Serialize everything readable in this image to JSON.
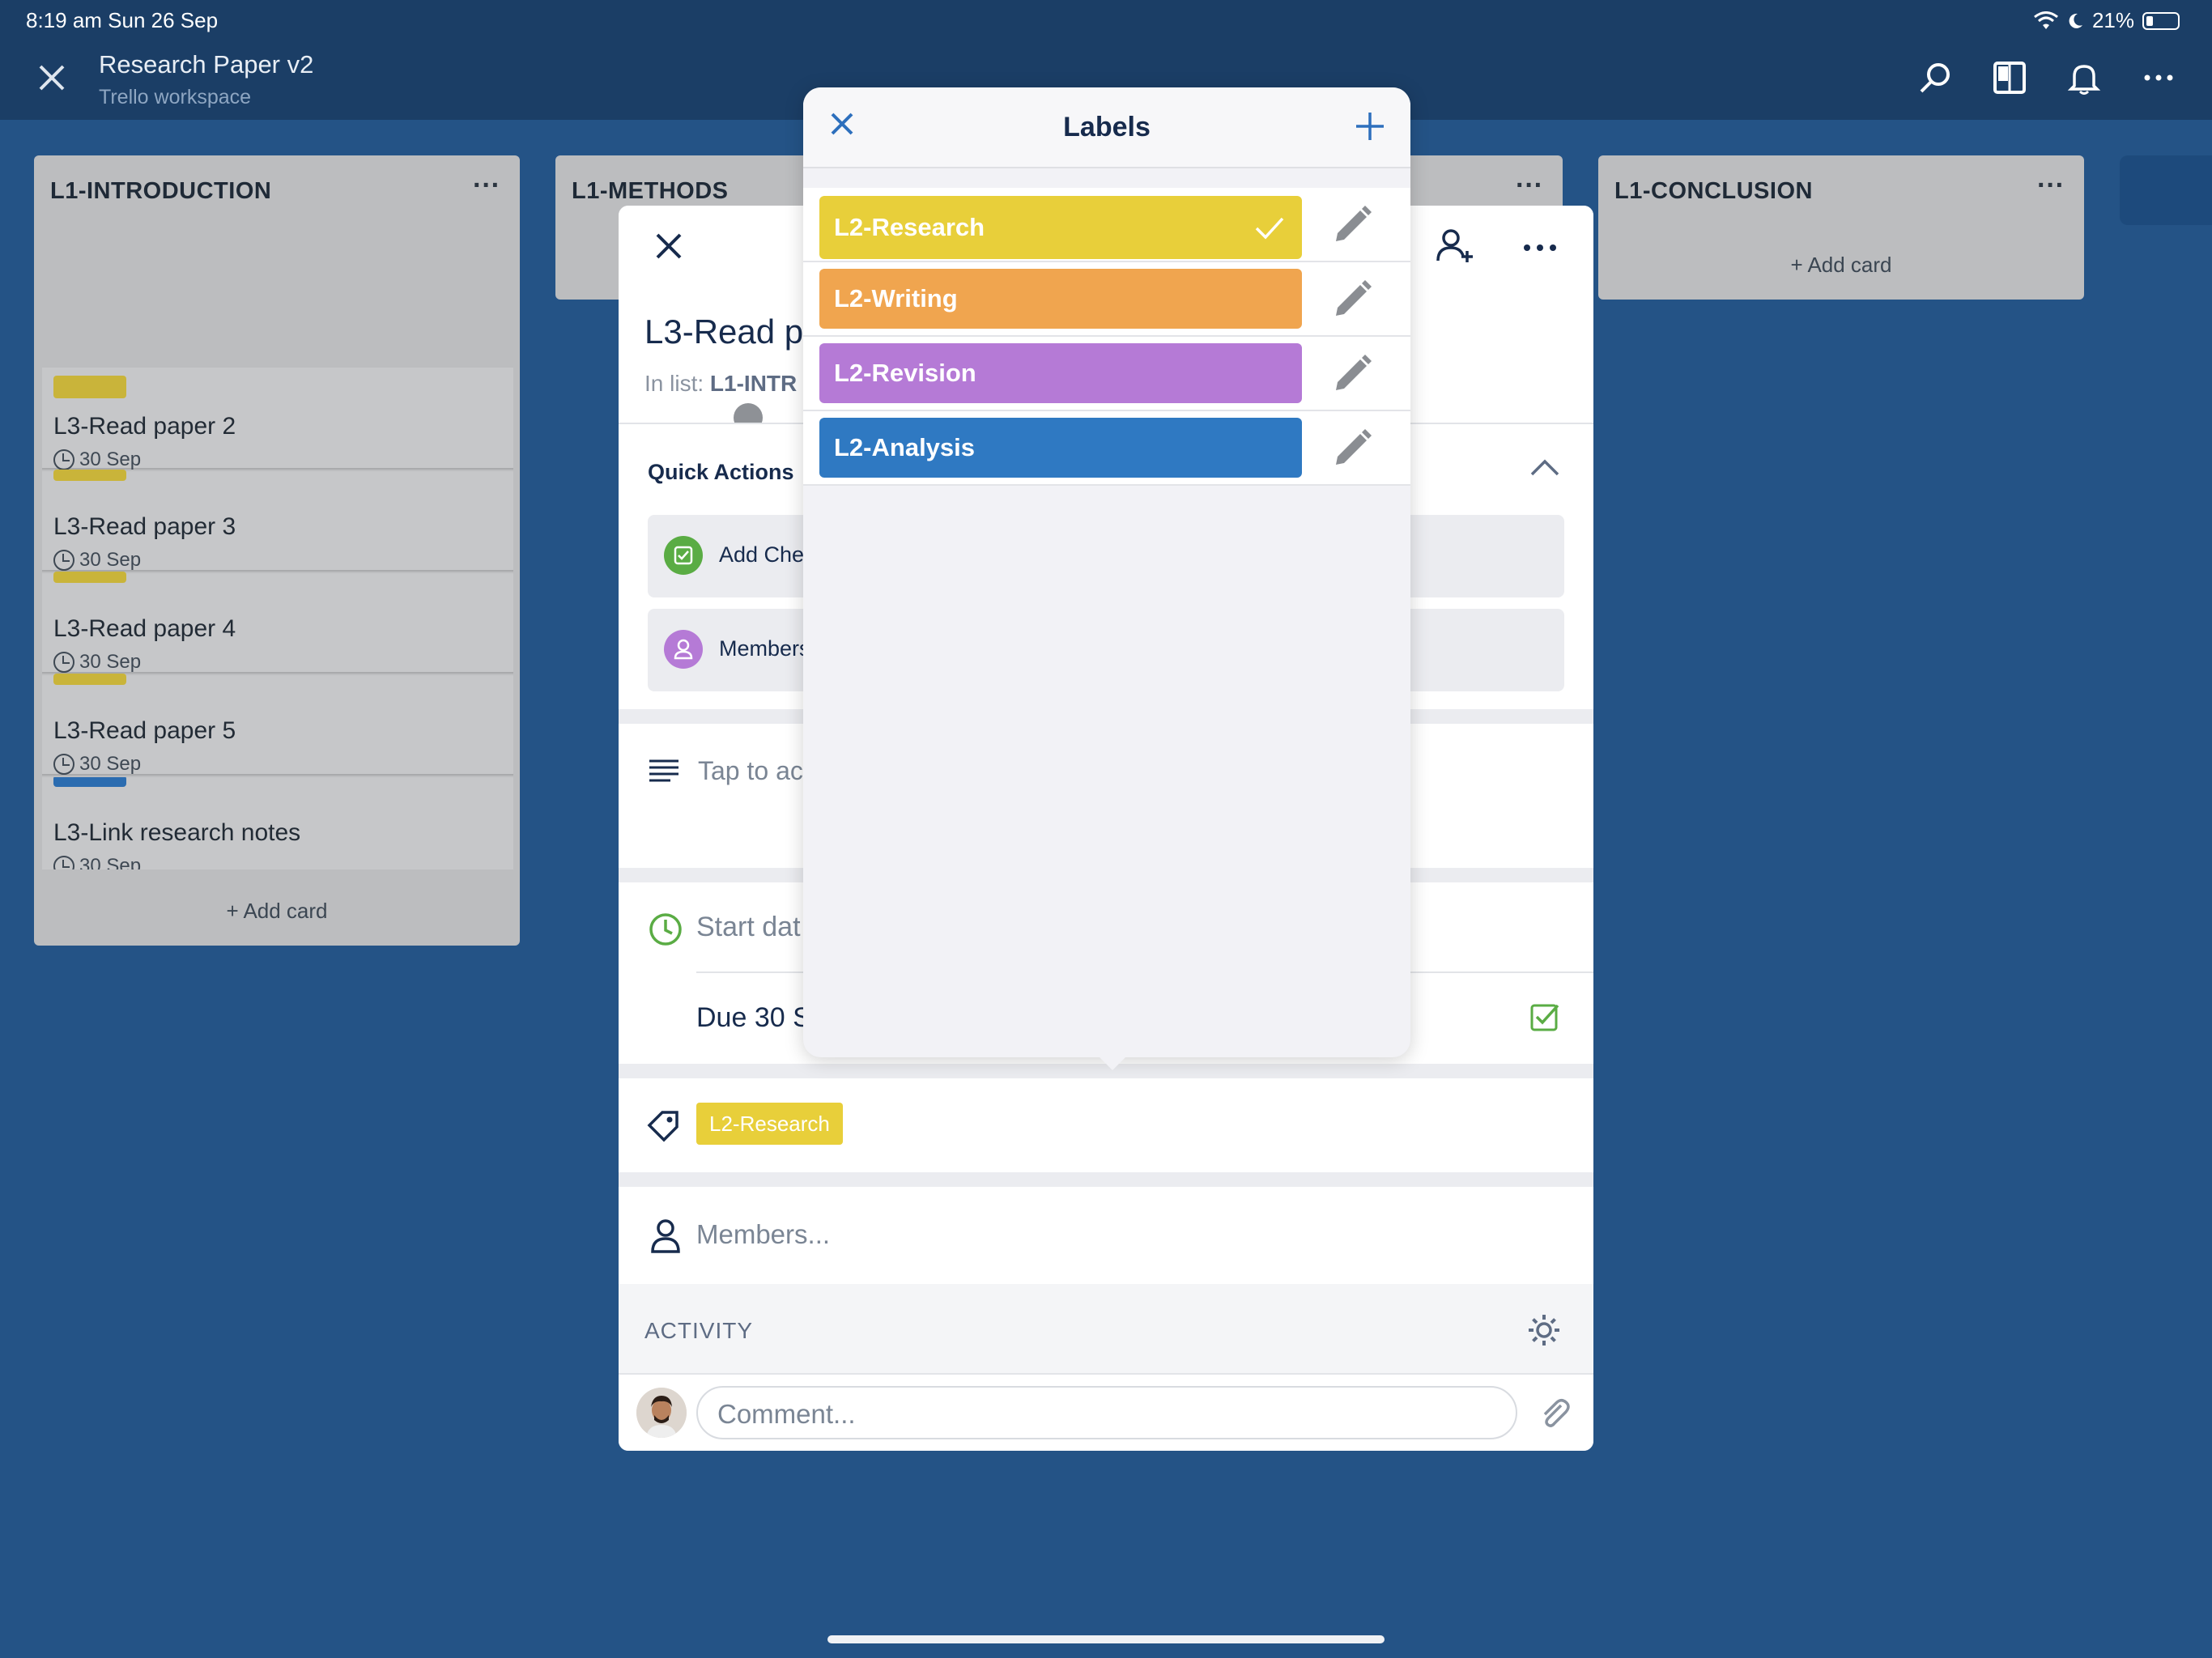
{
  "statusbar": {
    "time": "8:19 am   Sun 26 Sep",
    "battery": "21%"
  },
  "header": {
    "title": "Research Paper v2",
    "subtitle": "Trello workspace"
  },
  "lists": {
    "introduction": {
      "title": "L1-INTRODUCTION",
      "add_card": "+ Add card",
      "cards": [
        {
          "title": "L3-Read paper 2",
          "date": "30 Sep",
          "label_color": "#c9b43a"
        },
        {
          "title": "L3-Read paper 3",
          "date": "30 Sep",
          "label_color": "#c9b43a"
        },
        {
          "title": "L3-Read paper 4",
          "date": "30 Sep",
          "label_color": "#c9b43a"
        },
        {
          "title": "L3-Read paper 5",
          "date": "30 Sep",
          "label_color": "#c9b43a"
        },
        {
          "title": "L3-Link research notes",
          "date": "30 Sep",
          "label_color": "#2b6cb0"
        }
      ]
    },
    "methods": {
      "title": "L1-METHODS"
    },
    "conclusion": {
      "title": "L1-CONCLUSION",
      "add_card": "+ Add card"
    }
  },
  "card_detail": {
    "title": "L3-Read p",
    "in_list_prefix": "In list:",
    "in_list_name": "L1-INTR",
    "quick_actions": "Quick Actions",
    "add_checklist": "Add Che",
    "members_action": "Members",
    "description_placeholder": "Tap to ac",
    "start_date": "Start dat",
    "due_date": "Due 30 S",
    "label_chip": "L2-Research",
    "members_placeholder": "Members...",
    "activity": "ACTIVITY",
    "comment_placeholder": "Comment..."
  },
  "labels_popover": {
    "title": "Labels",
    "labels": [
      {
        "name": "L2-Research",
        "color": "#e8cf3a",
        "checked": true
      },
      {
        "name": "L2-Writing",
        "color": "#f0a54f",
        "checked": false
      },
      {
        "name": "L2-Revision",
        "color": "#b57ad6",
        "checked": false
      },
      {
        "name": "L2-Analysis",
        "color": "#2f79c2",
        "checked": false
      }
    ]
  },
  "colors": {
    "board_bg": "#245386",
    "topbar_bg": "#1b3e66",
    "accent": "#2d6fbd"
  }
}
